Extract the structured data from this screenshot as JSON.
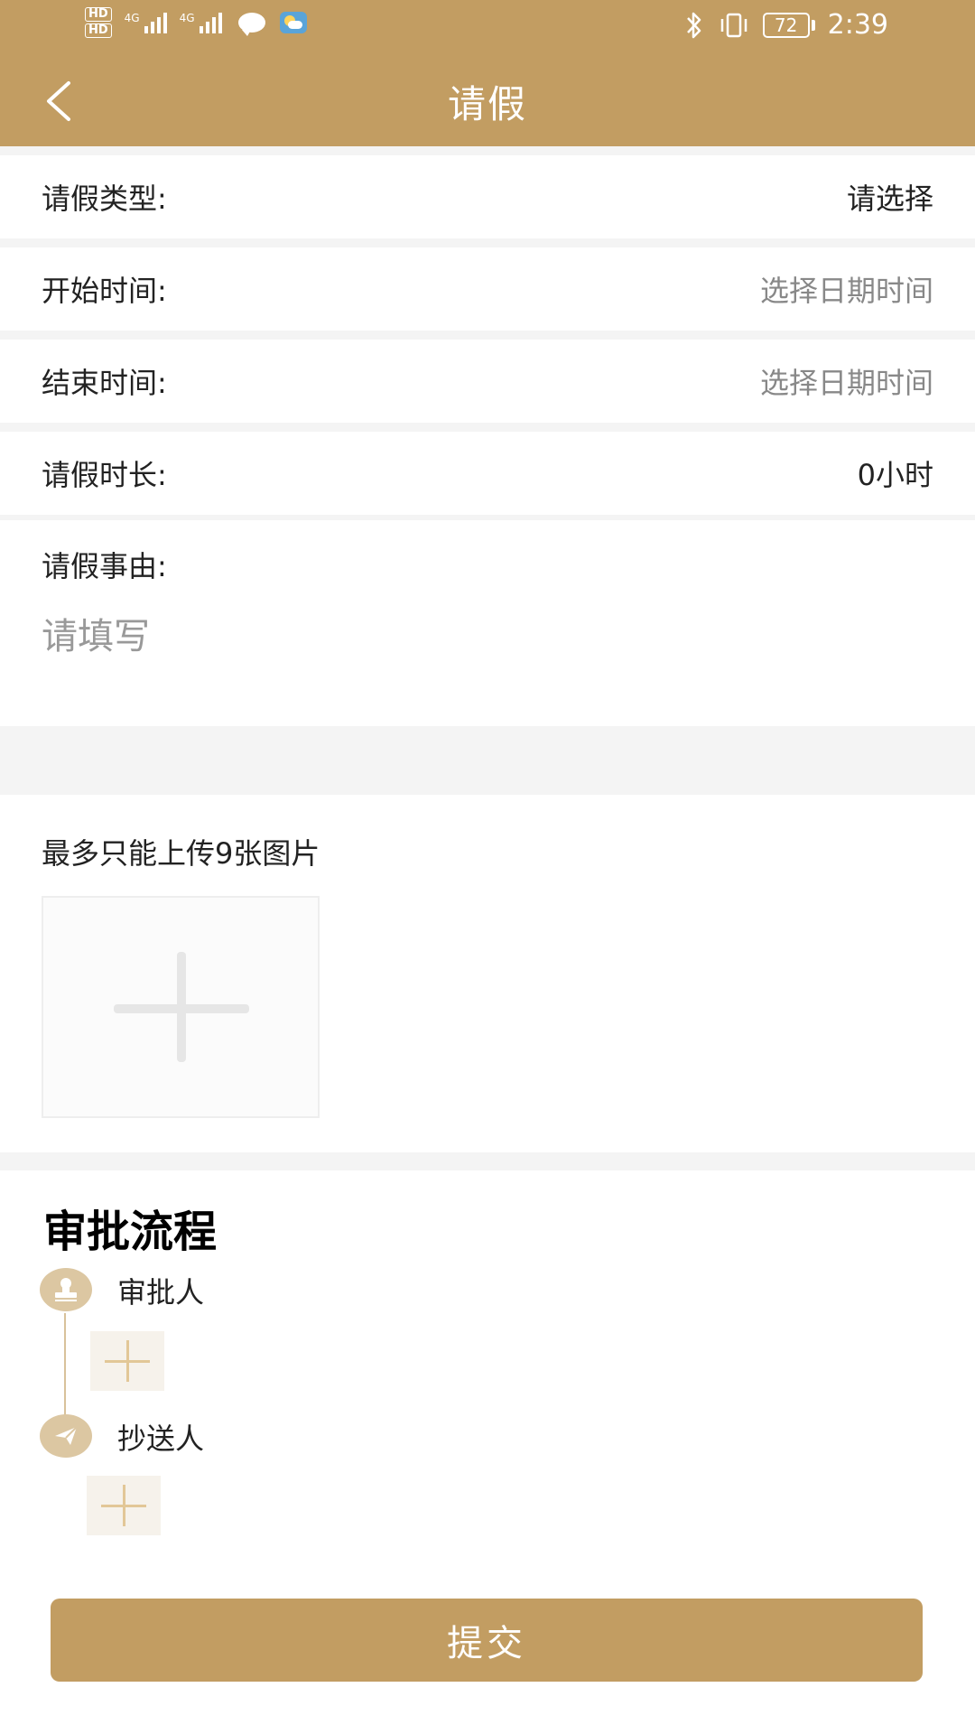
{
  "status_bar": {
    "hd1": "HD",
    "hd2": "HD",
    "net1": "4G",
    "net2": "4G",
    "battery": "72",
    "time": "2:39"
  },
  "header": {
    "title": "请假"
  },
  "form": {
    "rows": [
      {
        "label": "请假类型:",
        "value": "请选择"
      },
      {
        "label": "开始时间:",
        "value": "选择日期时间"
      },
      {
        "label": "结束时间:",
        "value": "选择日期时间"
      },
      {
        "label": "请假时长:",
        "value": "0小时"
      }
    ],
    "reason_label": "请假事由:",
    "reason_placeholder": "请填写"
  },
  "upload": {
    "hint": "最多只能上传9张图片"
  },
  "approval": {
    "title": "审批流程",
    "approver_label": "审批人",
    "cc_label": "抄送人"
  },
  "submit_label": "提交",
  "colors": {
    "brand": "#c29d62",
    "icon_bg": "#dcc7a2",
    "divider": "#f4f4f4"
  }
}
